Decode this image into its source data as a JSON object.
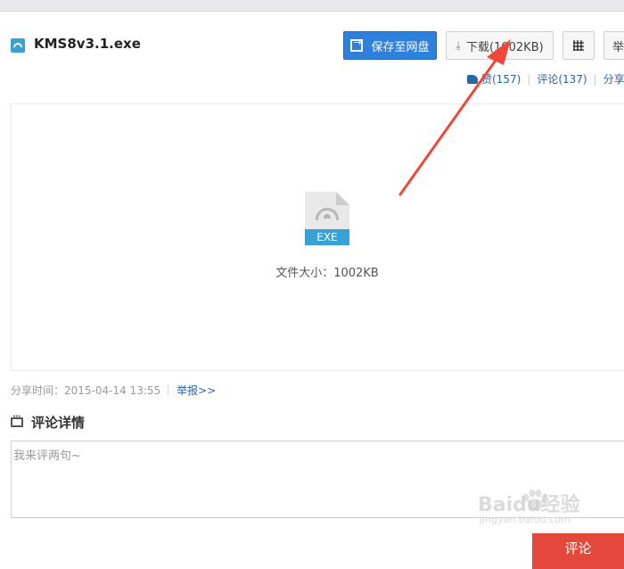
{
  "file": {
    "name": "KMS8v3.1.exe",
    "ext_tag": "EXE",
    "size_label": "文件大小：1002KB"
  },
  "toolbar": {
    "save_label": "保存至网盘",
    "download_label": "下载(1002KB)",
    "report_label": "举"
  },
  "actions": {
    "like_label": "赞(157)",
    "comment_label": "评论(137)",
    "share_label": "分享"
  },
  "share_info": {
    "time_label": "分享时间：2015-04-14 13:55",
    "report_link": "举报>>"
  },
  "comments": {
    "title": "评论详情",
    "input_placeholder": "我来评两句~",
    "submit_label": "评论"
  },
  "watermark": {
    "brand": "Baidu经验",
    "url": "jingyan.baidu.com"
  },
  "colors": {
    "primary_blue": "#2e80dd",
    "link_blue": "#2a64a8",
    "file_tag": "#3aa1d6",
    "submit_red": "#e4483a",
    "arrow_red": "#f0473a"
  }
}
